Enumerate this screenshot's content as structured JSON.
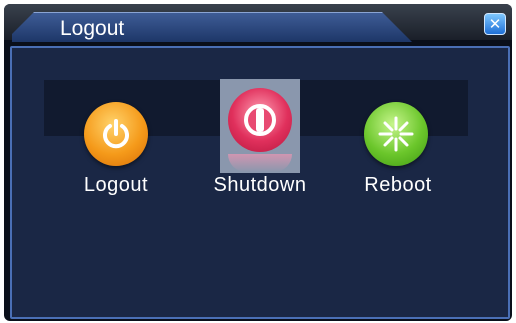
{
  "window": {
    "title": "Logout",
    "close_glyph": "✕"
  },
  "options": [
    {
      "label": "Logout",
      "icon": "power-icon",
      "color": "#f59a1a",
      "selected": false
    },
    {
      "label": "Shutdown",
      "icon": "shutdown-icon",
      "color": "#e0305c",
      "selected": true
    },
    {
      "label": "Reboot",
      "icon": "reboot-icon",
      "color": "#6bc62b",
      "selected": false
    }
  ]
}
